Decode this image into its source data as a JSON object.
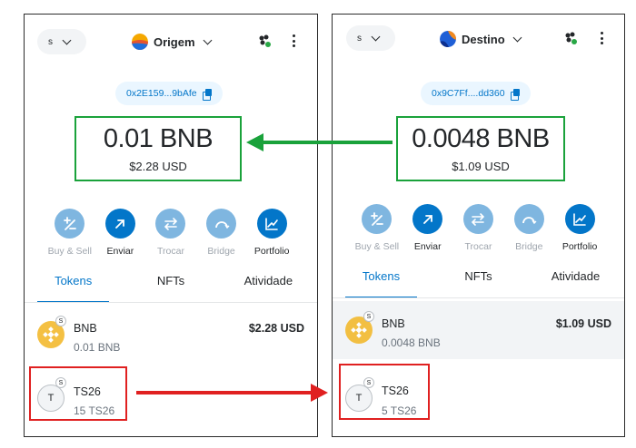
{
  "panels": {
    "left": {
      "network": "s",
      "account_name": "Origem",
      "address": "0x2E159...9bAfe",
      "balance_main": "0.01 BNB",
      "balance_fiat": "$2.28 USD",
      "actions": [
        "Buy & Sell",
        "Enviar",
        "Trocar",
        "Bridge",
        "Portfolio"
      ],
      "tabs": [
        "Tokens",
        "NFTs",
        "Atividade"
      ],
      "tokens": [
        {
          "name": "BNB",
          "balance": "0.01 BNB",
          "fiat": "$2.28 USD"
        },
        {
          "name": "TS26",
          "balance": "15 TS26",
          "icon_letter": "T",
          "badge": "S"
        }
      ]
    },
    "right": {
      "network": "s",
      "account_name": "Destino",
      "address": "0x9C7Ff....dd360",
      "balance_main": "0.0048 BNB",
      "balance_fiat": "$1.09 USD",
      "actions": [
        "Buy & Sell",
        "Enviar",
        "Trocar",
        "Bridge",
        "Portfolio"
      ],
      "tabs": [
        "Tokens",
        "NFTs",
        "Atividade"
      ],
      "tokens": [
        {
          "name": "BNB",
          "balance": "0.0048 BNB",
          "fiat": "$1.09 USD"
        },
        {
          "name": "TS26",
          "balance": "5 TS26",
          "icon_letter": "T",
          "badge": "S"
        }
      ]
    }
  },
  "colors": {
    "accent": "#0376c9",
    "highlight_green": "#1aa23b",
    "highlight_red": "#e02020",
    "bnb_yellow": "#f3ba2f"
  },
  "icons": {
    "actions": [
      "buy-sell-icon",
      "send-icon",
      "swap-icon",
      "bridge-icon",
      "portfolio-icon"
    ]
  }
}
